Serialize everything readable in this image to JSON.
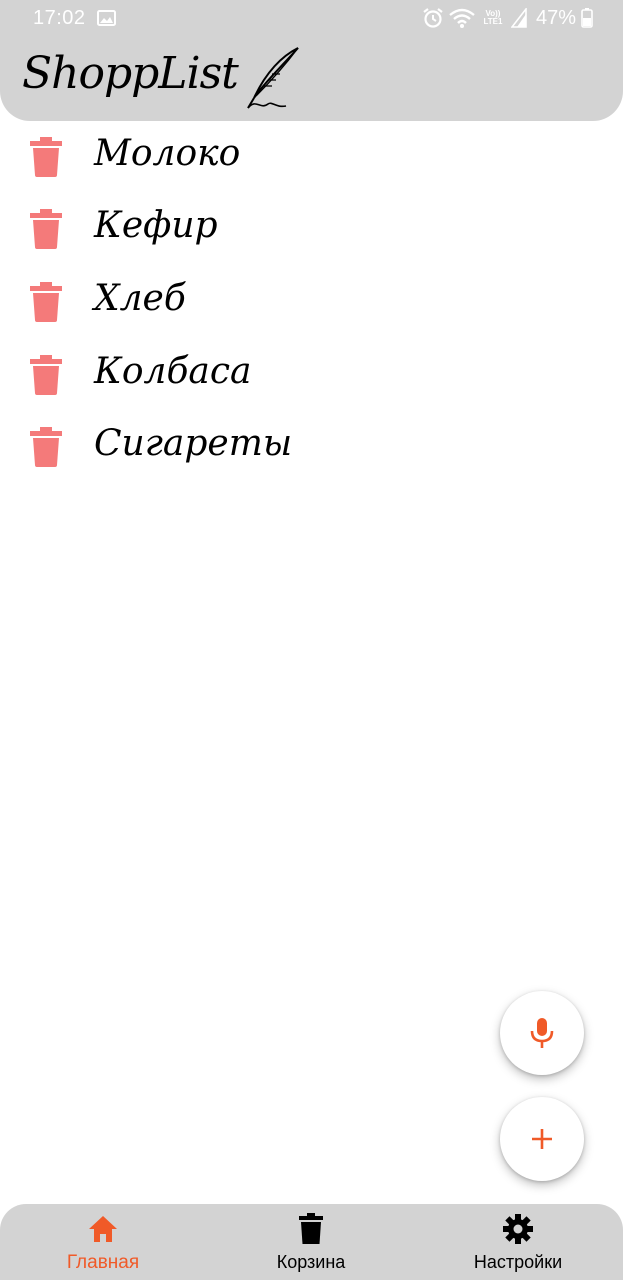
{
  "status_bar": {
    "time": "17:02",
    "network": "Vo)) LTE1",
    "battery": "47%",
    "icons": [
      "gallery-icon",
      "alarm-icon",
      "wifi-icon",
      "signal-icon",
      "battery-icon"
    ]
  },
  "header": {
    "title": "ShoppList",
    "icon": "quill-icon",
    "background": "#d3d3d3"
  },
  "items": [
    {
      "label": "Молоко"
    },
    {
      "label": "Кефир"
    },
    {
      "label": "Хлеб"
    },
    {
      "label": "Колбаса"
    },
    {
      "label": "Сигареты"
    }
  ],
  "fabs": {
    "mic_icon": "microphone-icon",
    "add_icon": "plus-icon"
  },
  "bottom_nav": {
    "items": [
      {
        "label": "Главная",
        "icon": "home-icon",
        "active": true
      },
      {
        "label": "Корзина",
        "icon": "trash-icon",
        "active": false
      },
      {
        "label": "Настройки",
        "icon": "gear-icon",
        "active": false
      }
    ]
  },
  "colors": {
    "accent": "#f05a28",
    "trash": "#f47a7a",
    "bars": "#d3d3d3",
    "text": "#000000"
  }
}
